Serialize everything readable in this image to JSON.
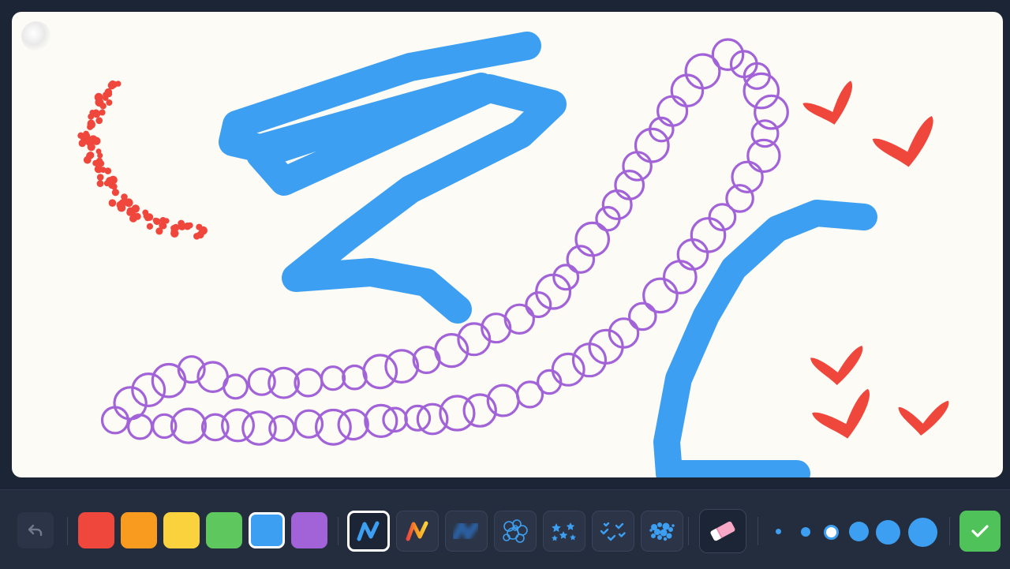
{
  "canvas": {
    "background": "#fcfbf5",
    "strokes": [
      {
        "brush": "scatter-dots",
        "color": "#f0473d"
      },
      {
        "brush": "marker",
        "color": "#3d9ff2"
      },
      {
        "brush": "bubbles",
        "color": "#a262d8"
      },
      {
        "brush": "marker",
        "color": "#3d9ff2"
      },
      {
        "brush": "hearts",
        "color": "#f0473d"
      }
    ]
  },
  "toolbar": {
    "undo_icon": "undo-arrow-icon",
    "colors": [
      {
        "name": "red",
        "hex": "#f0473d"
      },
      {
        "name": "orange",
        "hex": "#f89b1e"
      },
      {
        "name": "yellow",
        "hex": "#f9d23d"
      },
      {
        "name": "green",
        "hex": "#5ec85f"
      },
      {
        "name": "blue",
        "hex": "#3d9ff2",
        "selected": true
      },
      {
        "name": "purple",
        "hex": "#a262d8"
      }
    ],
    "brushes": [
      {
        "name": "pen",
        "icon": "pen-zigzag-icon",
        "selected": true
      },
      {
        "name": "rainbow",
        "icon": "rainbow-zigzag-icon"
      },
      {
        "name": "blur",
        "icon": "blur-brush-icon"
      },
      {
        "name": "bubbles",
        "icon": "bubbles-brush-icon"
      },
      {
        "name": "stars",
        "icon": "stars-brush-icon"
      },
      {
        "name": "checks",
        "icon": "checks-brush-icon"
      },
      {
        "name": "splatter",
        "icon": "splatter-brush-icon"
      }
    ],
    "eraser_icon": "eraser-icon",
    "sizes": [
      "xs",
      "s",
      "m",
      "l",
      "xl",
      "xxl"
    ],
    "selected_size": "m",
    "done_icon": "checkmark-icon"
  }
}
